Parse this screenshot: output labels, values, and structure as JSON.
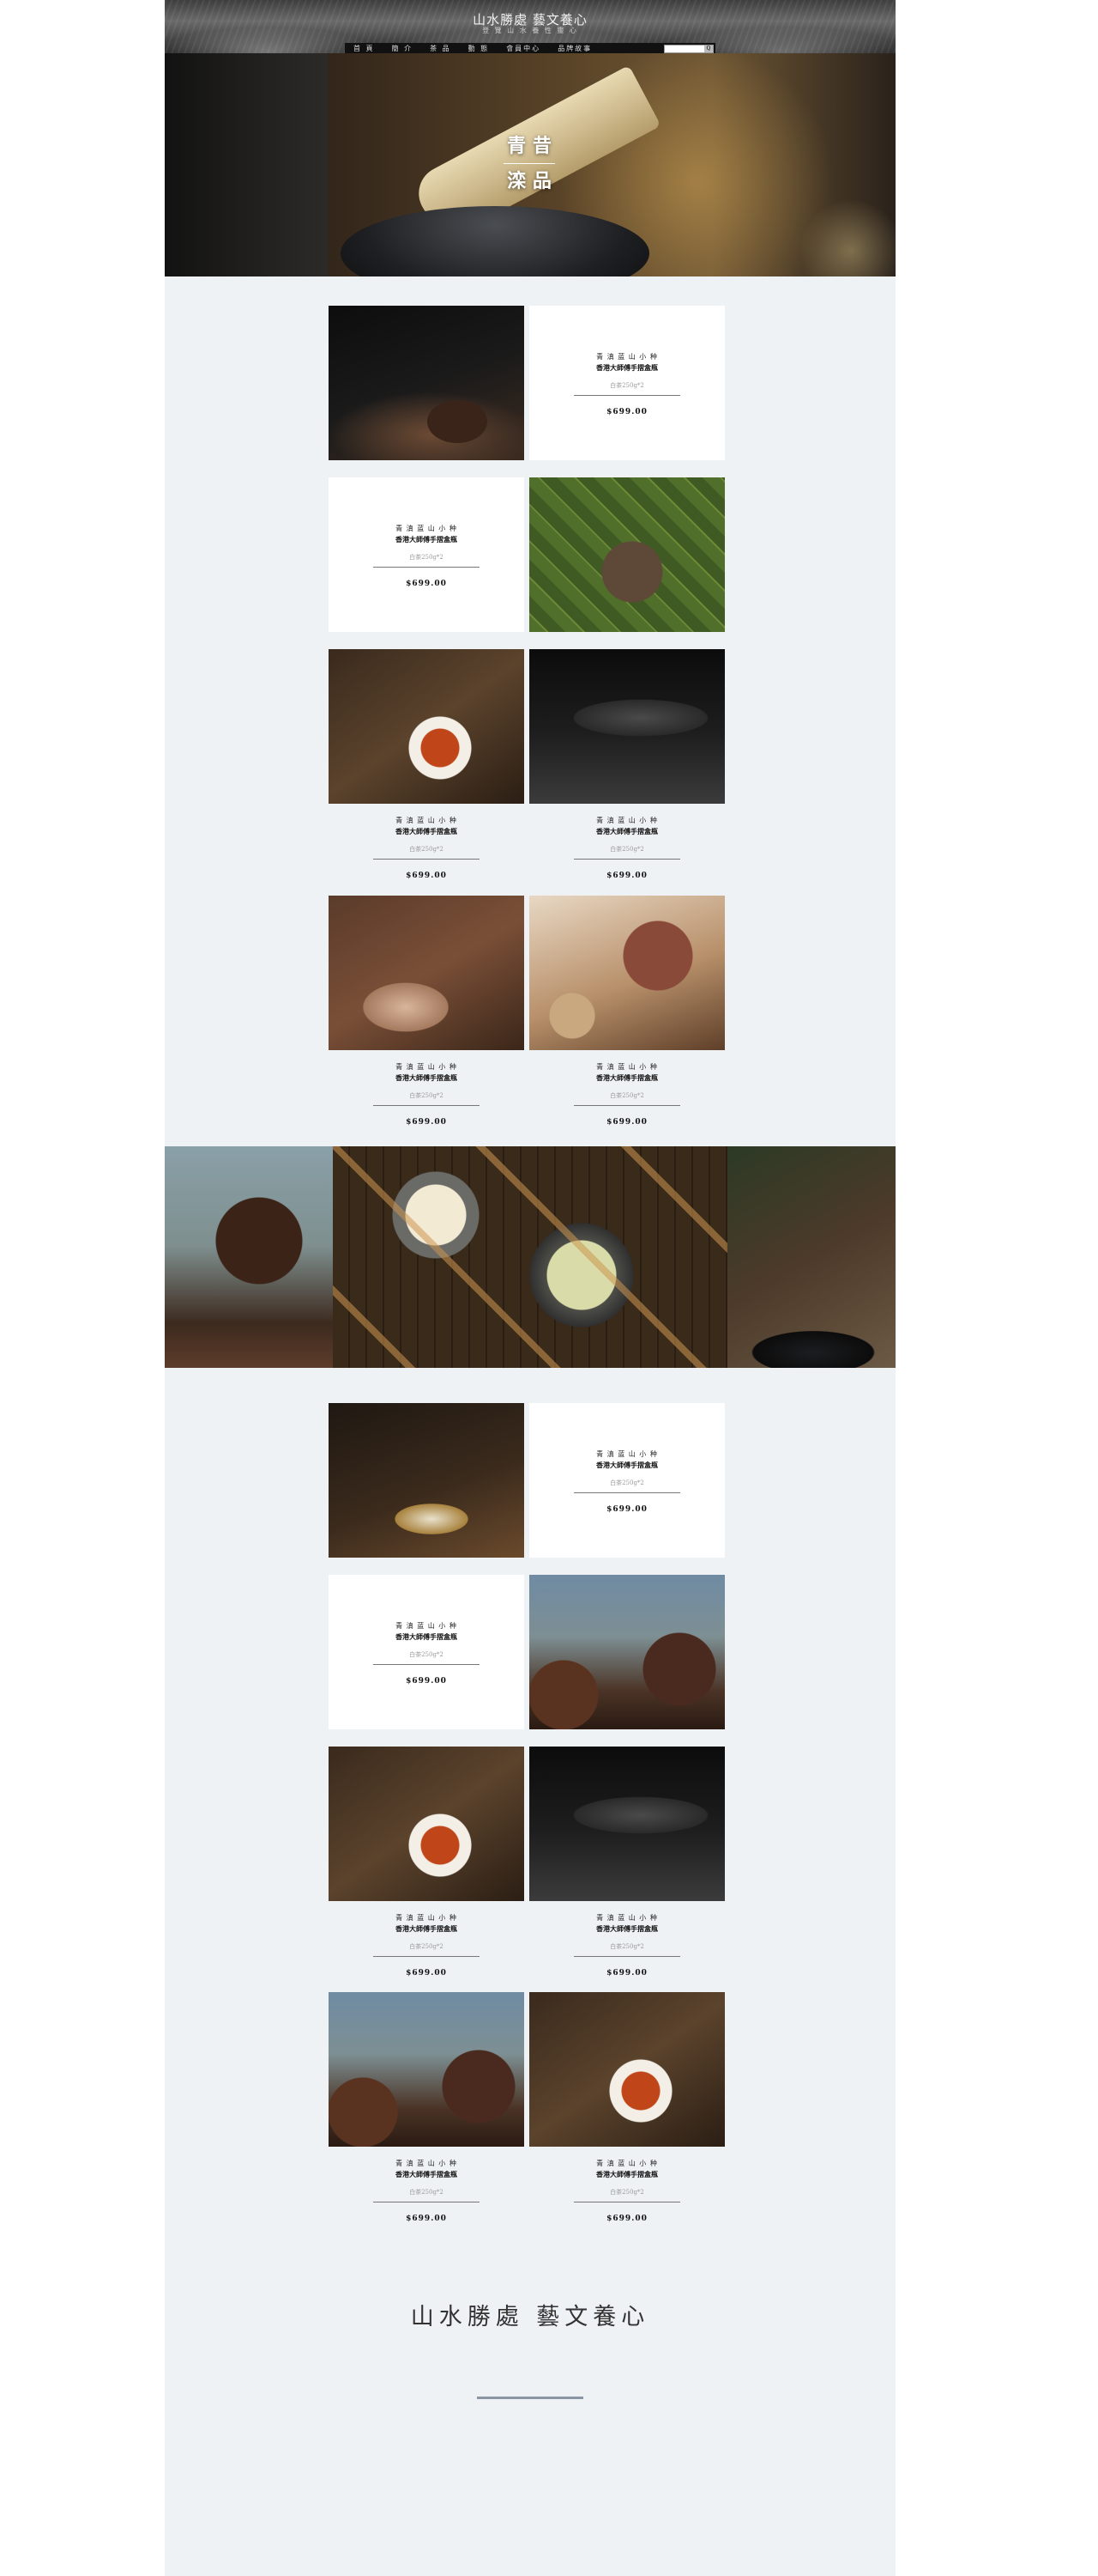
{
  "header": {
    "title": "山水勝處 藝文養心",
    "subtitle": "登 覽 山 水 養 性 靈 心",
    "nav": [
      "首 頁",
      "簡 介",
      "茶 品",
      "動 態",
      "會員中心",
      "品牌故事"
    ],
    "search": {
      "placeholder": "",
      "button_label": "Q"
    }
  },
  "hero": {
    "title_line1": "青 昔",
    "title_line2": "滦 品"
  },
  "products": [
    {
      "brand": "青 滇  蓝 山 小 种",
      "name": "香港大師傅手摺盒瓶",
      "spec": "白茶250g*2",
      "price": "$699.00"
    },
    {
      "brand": "青 滇  蓝 山 小 种",
      "name": "香港大師傅手摺盒瓶",
      "spec": "白茶250g*2",
      "price": "$699.00"
    },
    {
      "brand": "青 滇  蓝 山 小 种",
      "name": "香港大師傅手摺盒瓶",
      "spec": "白茶250g*2",
      "price": "$699.00"
    },
    {
      "brand": "青 滇  蓝 山 小 种",
      "name": "香港大師傅手摺盒瓶",
      "spec": "白茶250g*2",
      "price": "$699.00"
    },
    {
      "brand": "青 滇  蓝 山 小 种",
      "name": "香港大師傅手摺盒瓶",
      "spec": "白茶250g*2",
      "price": "$699.00"
    },
    {
      "brand": "青 滇  蓝 山 小 种",
      "name": "香港大師傅手摺盒瓶",
      "spec": "白茶250g*2",
      "price": "$699.00"
    },
    {
      "brand": "青 滇  蓝 山 小 种",
      "name": "香港大師傅手摺盒瓶",
      "spec": "白茶250g*2",
      "price": "$699.00"
    },
    {
      "brand": "青 滇  蓝 山 小 种",
      "name": "香港大師傅手摺盒瓶",
      "spec": "白茶250g*2",
      "price": "$699.00"
    },
    {
      "brand": "青 滇  蓝 山 小 种",
      "name": "香港大師傅手摺盒瓶",
      "spec": "白茶250g*2",
      "price": "$699.00"
    },
    {
      "brand": "青 滇  蓝 山 小 种",
      "name": "香港大師傅手摺盒瓶",
      "spec": "白茶250g*2",
      "price": "$699.00"
    },
    {
      "brand": "青 滇  蓝 山 小 种",
      "name": "香港大師傅手摺盒瓶",
      "spec": "白茶250g*2",
      "price": "$699.00"
    },
    {
      "brand": "青 滇  蓝 山 小 种",
      "name": "香港大師傅手摺盒瓶",
      "spec": "白茶250g*2",
      "price": "$699.00"
    }
  ],
  "footer": {
    "title": "山水勝處 藝文養心"
  },
  "colors": {
    "background": "#eff2f5",
    "nav_bar": "#111111",
    "rule": "#8a96a3"
  }
}
